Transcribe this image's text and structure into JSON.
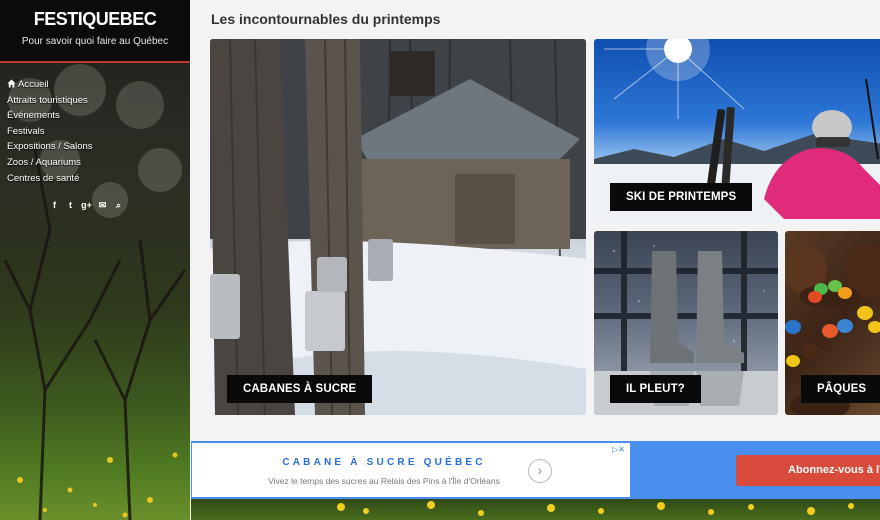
{
  "site": {
    "title": "FESTIQUEBEC",
    "tagline": "Pour savoir quoi faire au Québec"
  },
  "nav": {
    "items": [
      {
        "label": "Accueil",
        "icon": "home-icon"
      },
      {
        "label": "Attraits touristiques"
      },
      {
        "label": "Événements"
      },
      {
        "label": "Festivals"
      },
      {
        "label": "Expositions / Salons"
      },
      {
        "label": "Zoos / Aquariums"
      },
      {
        "label": "Centres de santé"
      }
    ]
  },
  "social": {
    "icons": [
      "facebook-icon",
      "twitter-icon",
      "google-plus-icon",
      "email-icon",
      "search-icon"
    ],
    "glyphs": {
      "facebook": "f",
      "twitter": "t",
      "google_plus": "g+",
      "email": "✉",
      "search": "⌕"
    }
  },
  "main": {
    "heading": "Les incontournables du printemps",
    "tiles": [
      {
        "label": "CABANES À SUCRE"
      },
      {
        "label": "SKI DE PRINTEMPS"
      },
      {
        "label": "IL PLEUT?"
      },
      {
        "label": "PÂQUES"
      }
    ]
  },
  "ad": {
    "title": "CABANE À SUCRE QUÉBEC",
    "description": "Vivez le temps des sucres au Relais des Pins à l'Île d'Orléans",
    "arrow": "›",
    "choices": "▷✕",
    "button": "Abonnez-vous à l'in"
  },
  "colors": {
    "accent": "#c0392b",
    "ad_blue": "#4a8ff0",
    "ad_button": "#d84a3a",
    "tile_label_bg": "#0a0a0a"
  }
}
